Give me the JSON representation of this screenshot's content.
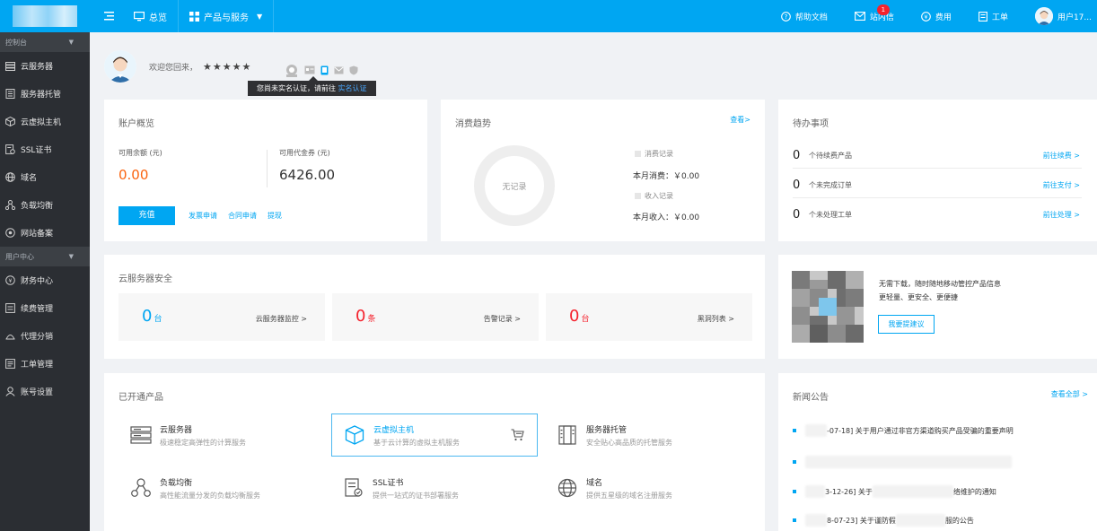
{
  "topbar": {
    "nav": {
      "overview": "总览",
      "products": "产品与服务"
    },
    "right": {
      "help": "帮助文档",
      "messages": "站内信",
      "messages_badge": "1",
      "billing": "费用",
      "tickets": "工单",
      "user": "用户17..."
    }
  },
  "sidebar": {
    "section1": "控制台",
    "items1": [
      {
        "icon": "server-icon",
        "label": "云服务器"
      },
      {
        "icon": "hosting-icon",
        "label": "服务器托管"
      },
      {
        "icon": "virtual-host-icon",
        "label": "云虚拟主机"
      },
      {
        "icon": "ssl-icon",
        "label": "SSL证书"
      },
      {
        "icon": "globe-icon",
        "label": "域名"
      },
      {
        "icon": "load-balance-icon",
        "label": "负载均衡"
      },
      {
        "icon": "record-icon",
        "label": "网站备案"
      }
    ],
    "section2": "用户中心",
    "items2": [
      {
        "icon": "finance-icon",
        "label": "财务中心"
      },
      {
        "icon": "renew-icon",
        "label": "续费管理"
      },
      {
        "icon": "agent-icon",
        "label": "代理分销"
      },
      {
        "icon": "ticket-icon",
        "label": "工单管理"
      },
      {
        "icon": "user-icon",
        "label": "账号设置"
      }
    ]
  },
  "welcome": {
    "text": "欢迎您回来，",
    "masked_name": "★★★★★",
    "tooltip_text": "您尚未实名认证，请前往",
    "tooltip_link": "实名认证"
  },
  "account": {
    "title": "账户概览",
    "balance_label": "可用余额 (元)",
    "balance_value": "0.00",
    "voucher_label": "可用代金券 (元)",
    "voucher_value": "6426.00",
    "recharge": "充值",
    "links": [
      "发票申请",
      "合同申请",
      "提现"
    ]
  },
  "trend": {
    "title": "消费趋势",
    "view": "查看>",
    "empty": "无记录",
    "legend_consume": "消费记录",
    "month_consume": "本月消费：￥0.00",
    "legend_income": "收入记录",
    "month_income": "本月收入：￥0.00"
  },
  "todo": {
    "title": "待办事项",
    "rows": [
      {
        "num": "0",
        "label": "个待续费产品",
        "link": "前往续费 >"
      },
      {
        "num": "0",
        "label": "个未完成订单",
        "link": "前往支付 >"
      },
      {
        "num": "0",
        "label": "个未处理工单",
        "link": "前往处理 >"
      }
    ]
  },
  "security": {
    "title": "云服务器安全",
    "boxes": [
      {
        "num": "0",
        "unit": "台",
        "color": "#00a6f2",
        "link": "云服务器监控 >"
      },
      {
        "num": "0",
        "unit": "条",
        "color": "#f5222d",
        "link": "告警记录 >"
      },
      {
        "num": "0",
        "unit": "台",
        "color": "#f5222d",
        "link": "黑洞列表 >"
      }
    ]
  },
  "promo": {
    "line1": "无需下载，随时随地移动管控产品信息",
    "line2": "更轻量、更安全、更便捷",
    "button": "我要提建议"
  },
  "products": {
    "title": "已开通产品",
    "items": [
      {
        "icon": "server-icon",
        "name": "云服务器",
        "desc": "极速稳定高弹性的计算服务"
      },
      {
        "icon": "cube-icon",
        "name": "云虚拟主机",
        "desc": "基于云计算的虚拟主机服务"
      },
      {
        "icon": "hosting-icon",
        "name": "服务器托管",
        "desc": "安全贴心高品质的托管服务"
      },
      {
        "icon": "load-balance-icon",
        "name": "负载均衡",
        "desc": "高性能流量分发的负载均衡服务"
      },
      {
        "icon": "ssl-icon",
        "name": "SSL证书",
        "desc": "提供一站式的证书部署服务"
      },
      {
        "icon": "globe-icon",
        "name": "域名",
        "desc": "提供五星级的域名注册服务"
      }
    ]
  },
  "news": {
    "title": "新闻公告",
    "view_all": "查看全部 >",
    "rows": [
      {
        "pre": "",
        "text": "-07-18] 关于用户通过非官方渠道购买产品受骗的重要声明"
      },
      {
        "pre": "",
        "text": ""
      },
      {
        "pre": "",
        "text": "3-12-26] 关于",
        "post": "络维护的通知"
      },
      {
        "pre": "",
        "text": "8-07-23] 关于谨防假",
        "post": "服的公告"
      }
    ]
  }
}
